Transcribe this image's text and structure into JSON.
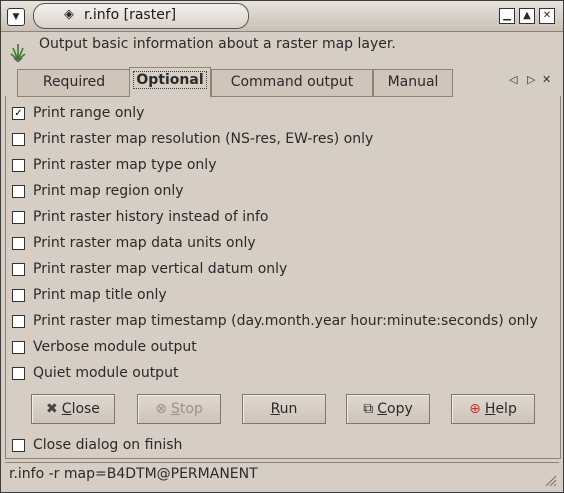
{
  "window": {
    "title": "r.info [raster]"
  },
  "header": {
    "description": "Output basic information about a raster map layer."
  },
  "tabs": [
    {
      "label": "Required",
      "active": false
    },
    {
      "label": "Optional",
      "active": true
    },
    {
      "label": "Command output",
      "active": false
    },
    {
      "label": "Manual",
      "active": false
    }
  ],
  "options": [
    {
      "label": "Print range only",
      "checked": true
    },
    {
      "label": "Print raster map resolution (NS-res, EW-res) only",
      "checked": false
    },
    {
      "label": "Print raster map type only",
      "checked": false
    },
    {
      "label": "Print map region only",
      "checked": false
    },
    {
      "label": "Print raster history instead of info",
      "checked": false
    },
    {
      "label": "Print raster map data units only",
      "checked": false
    },
    {
      "label": "Print raster map vertical datum only",
      "checked": false
    },
    {
      "label": "Print map title only",
      "checked": false
    },
    {
      "label": "Print raster map timestamp (day.month.year hour:minute:seconds) only",
      "checked": false
    },
    {
      "label": "Verbose module output",
      "checked": false
    },
    {
      "label": "Quiet module output",
      "checked": false
    }
  ],
  "buttons": {
    "close": {
      "mnemonic": "C",
      "rest": "lose"
    },
    "stop": {
      "mnemonic": "S",
      "rest": "top"
    },
    "run": {
      "mnemonic": "R",
      "rest": "un"
    },
    "copy": {
      "mnemonic": "C",
      "rest": "opy"
    },
    "help": {
      "mnemonic": "H",
      "rest": "elp"
    }
  },
  "close_on_finish": {
    "label": "Close dialog on finish",
    "checked": false
  },
  "status": {
    "command": "r.info -r map=B4DTM@PERMANENT"
  }
}
